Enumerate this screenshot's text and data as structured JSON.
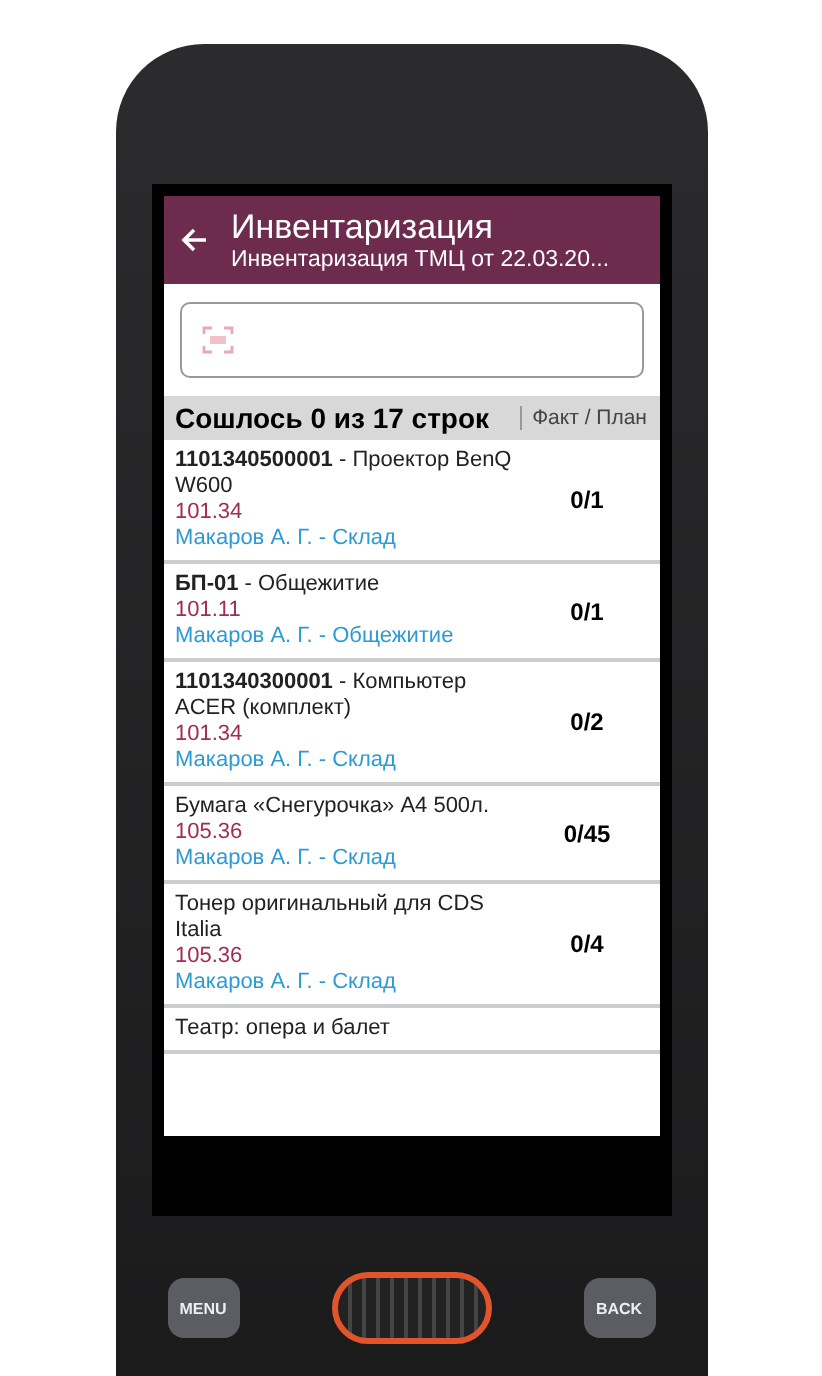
{
  "app_bar": {
    "title": "Инвентаризация",
    "subtitle": "Инвентаризация ТМЦ от 22.03.20..."
  },
  "summary": {
    "text": "Сошлось 0 из 17 строк",
    "column": "Факт / План"
  },
  "rows": [
    {
      "name": "**1101340500001** - Проектор BenQ W600",
      "account": "101.34",
      "owner": "Макаров А. Г. - Склад",
      "qty": "0/1"
    },
    {
      "name": "**БП-01** - Общежитие",
      "account": "101.11",
      "owner": "Макаров А. Г. - Общежитие",
      "qty": "0/1"
    },
    {
      "name": "**1101340300001** - Компьютер ACER (комплект)",
      "account": "101.34",
      "owner": "Макаров А. Г. - Склад",
      "qty": "0/2"
    },
    {
      "name": "Бумага «Снегурочка» А4 500л.",
      "account": "105.36",
      "owner": "Макаров А. Г. - Склад",
      "qty": "0/45"
    },
    {
      "name": "Тонер оригинальный для CDS Italia",
      "account": "105.36",
      "owner": "Макаров А. Г. - Склад",
      "qty": "0/4"
    },
    {
      "name": "Театр: опера и балет"
    }
  ],
  "keys": {
    "left": "MENU",
    "right": "BACK"
  }
}
